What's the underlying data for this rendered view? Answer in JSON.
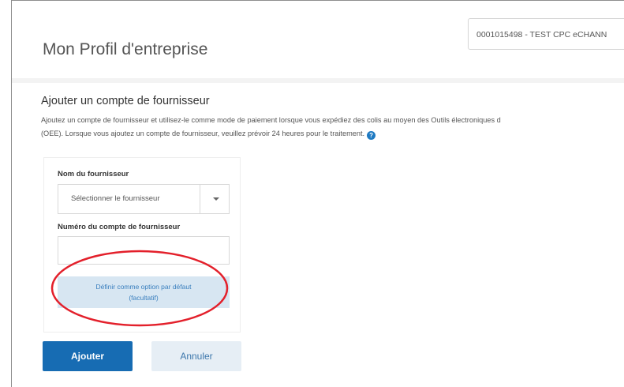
{
  "header": {
    "account_selector": "0001015498 - TEST CPC eCHANN",
    "page_title": "Mon Profil d'entreprise"
  },
  "section": {
    "title": "Ajouter un compte de fournisseur",
    "description_line1": "Ajoutez un compte de fournisseur et utilisez-le comme mode de paiement lorsque vous expédiez des colis au moyen des Outils électroniques d",
    "description_line2": "(OEE). Lorsque vous ajoutez un compte de fournisseur, veuillez prévoir 24 heures pour le traitement.",
    "help_icon": "question-circle-icon"
  },
  "form": {
    "supplier_label": "Nom du fournisseur",
    "supplier_select_value": "Sélectionner le fournisseur",
    "account_number_label": "Numéro du compte de fournisseur",
    "account_number_value": "",
    "default_option_line1": "Définir comme option par défaut",
    "default_option_line2": "(facultatif)"
  },
  "buttons": {
    "add": "Ajouter",
    "cancel": "Annuler"
  },
  "colors": {
    "primary": "#176cb3",
    "secondary_bg": "#e6eef5",
    "default_option_bg": "#d7e6f2",
    "highlight": "#e3202b"
  }
}
